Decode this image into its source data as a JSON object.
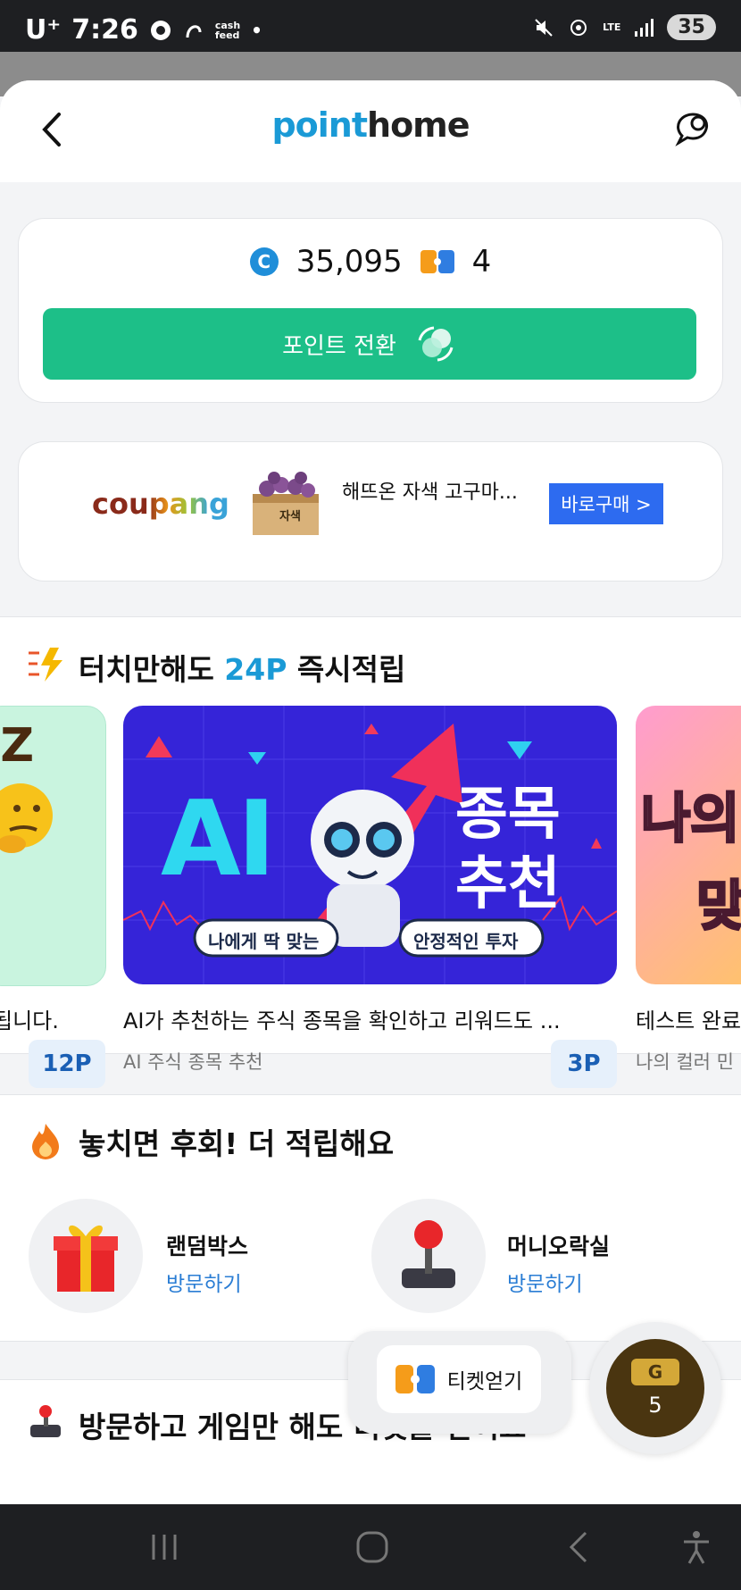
{
  "status_bar": {
    "carrier": "U⁺",
    "time": "7:26",
    "app_label_1": "cash",
    "app_label_2": "feed",
    "network": "LTE",
    "battery": "35"
  },
  "header": {
    "logo_part1": "point",
    "logo_part2": "home"
  },
  "points": {
    "coin_symbol": "C",
    "balance": "35,095",
    "tickets": "4",
    "convert_label": "포인트 전환"
  },
  "ad": {
    "brand": "coupang",
    "product": "해뜨온 자색 고구마...",
    "box_label": "자색",
    "buy_label": "바로구매 >"
  },
  "touch_section": {
    "title_prefix": "터치만해도 ",
    "title_highlight": "24P",
    "title_suffix": " 즉시적립",
    "cards": [
      {
        "partial_text": "IZ",
        "caption": "됩니다.",
        "badge": "12P"
      },
      {
        "banner_left": "AI",
        "banner_right_1": "종목",
        "banner_right_2": "추천",
        "pill_left": "나에게 딱 맞는",
        "pill_right": "안정적인 투자",
        "caption": "AI가 추천하는 주식 종목을 확인하고 리워드도 ...",
        "sub": "AI 주식 종목 추천",
        "badge": "3P"
      },
      {
        "partial_text_1": "나의",
        "partial_text_2": "맞",
        "caption": "테스트 완료",
        "sub": "나의 컬러 민"
      }
    ]
  },
  "miss_section": {
    "title": "놓치면 후회! 더 적립해요",
    "items": [
      {
        "name": "랜덤박스",
        "link": "방문하기"
      },
      {
        "name": "머니오락실",
        "link": "방문하기"
      }
    ]
  },
  "game_section": {
    "title": "방문하고 게임만 해도 티켓을 얻어요"
  },
  "floating": {
    "ticket_button": "티켓얻기",
    "gold_letter": "G",
    "gold_count": "5"
  },
  "colors": {
    "accent_green": "#1dbf88",
    "brand_blue": "#1a9ad6",
    "buy_blue": "#2d6bf0"
  }
}
